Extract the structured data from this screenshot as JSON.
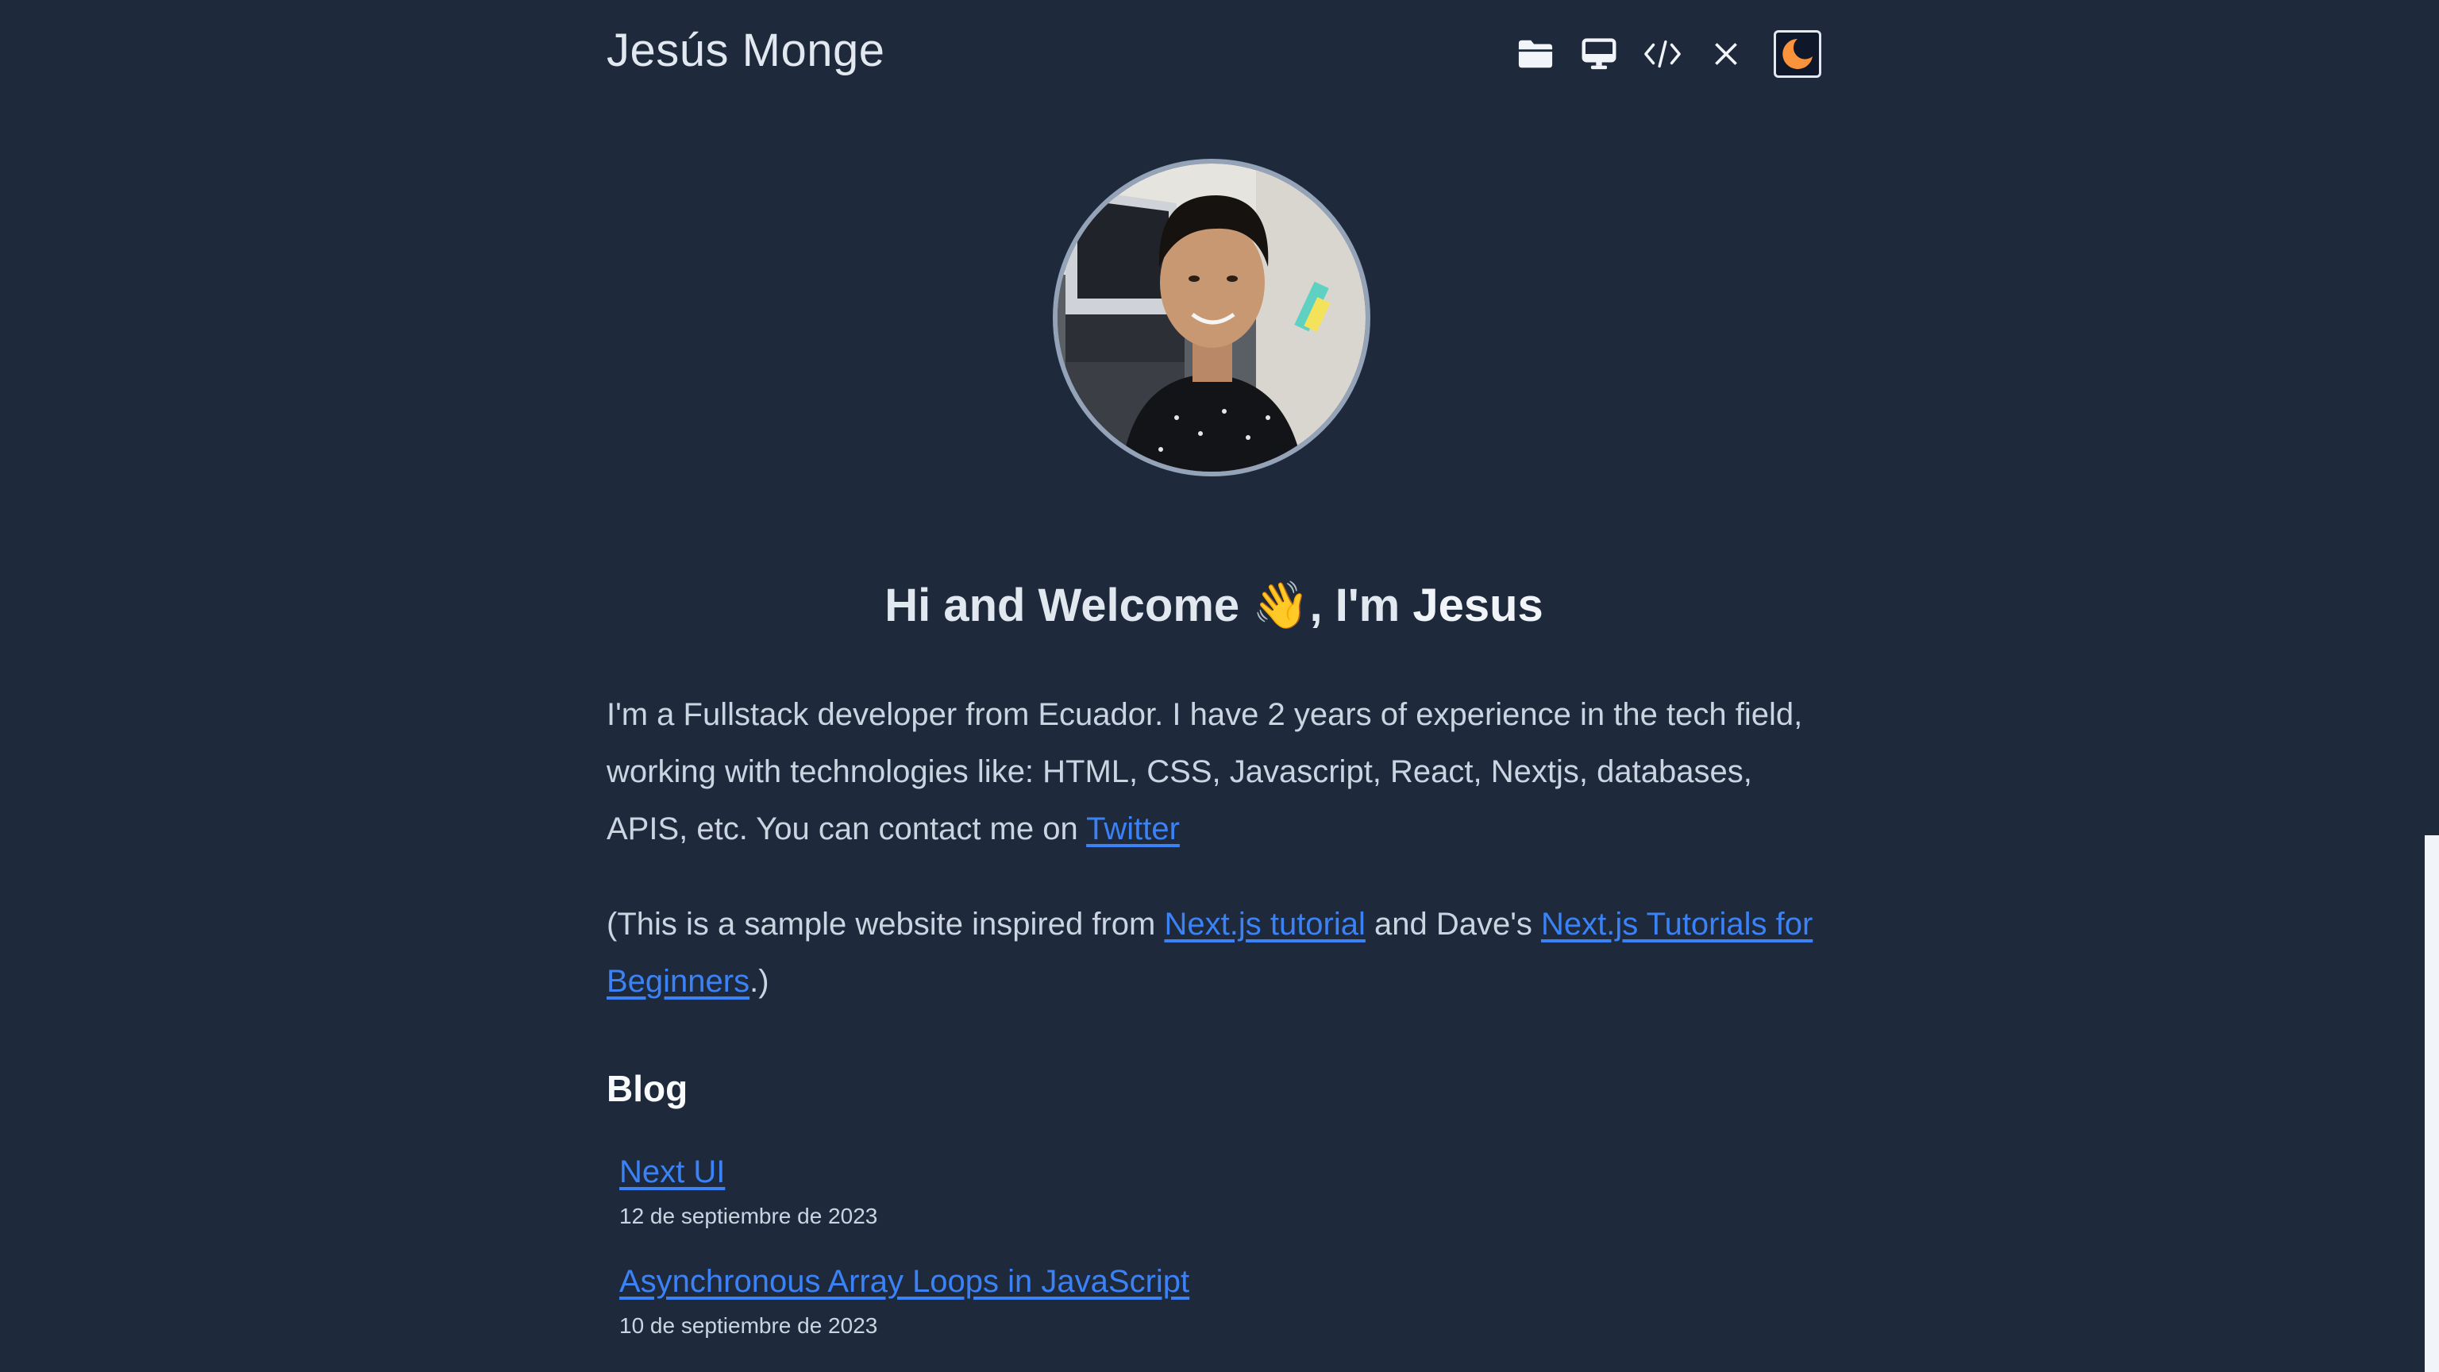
{
  "header": {
    "site_title": "Jesús Monge",
    "nav_icons": [
      "folder-icon",
      "monitor-icon",
      "code-icon",
      "x-close-icon",
      "moon-icon"
    ]
  },
  "hero": {
    "greeting_prefix": "Hi and Welcome ",
    "wave_emoji": "👋",
    "greeting_middle": ", I'm ",
    "greeting_name": "Jesus"
  },
  "intro": {
    "paragraph1_text": "I'm a Fullstack developer from Ecuador. I have 2 years of experience in the tech field, working with technologies like: HTML, CSS, Javascript, React, Nextjs, databases, APIS, etc. You can contact me on ",
    "twitter_link": "Twitter",
    "paragraph2_prefix": "(This is a sample website inspired from ",
    "nextjs_tutorial_link": "Next.js tutorial",
    "paragraph2_middle": " and Dave's ",
    "dave_tutorial_link": "Next.js Tutorials for Beginners",
    "paragraph2_suffix": ".)"
  },
  "blog": {
    "title": "Blog",
    "posts": [
      {
        "title": "Next UI",
        "date": "12 de septiembre de 2023"
      },
      {
        "title": "Asynchronous Array Loops in JavaScript",
        "date": "10 de septiembre de 2023"
      }
    ]
  },
  "colors": {
    "background": "#1e293b",
    "link": "#3b82f6",
    "text": "#cbd5e1",
    "heading": "#e2e8f0",
    "moon": "#fb923c"
  }
}
